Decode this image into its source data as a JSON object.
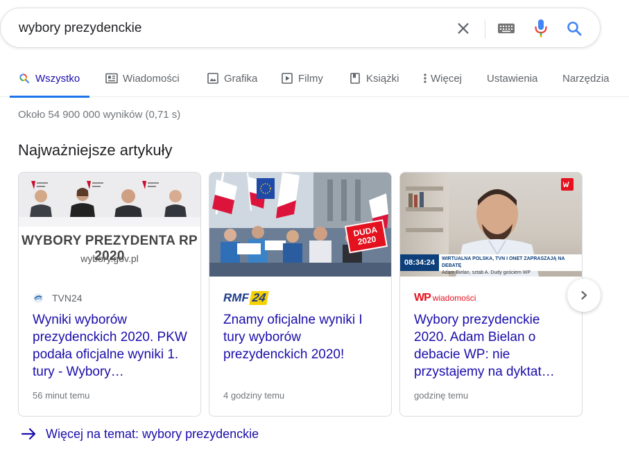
{
  "search": {
    "query": "wybory prezydenckie"
  },
  "tabs": [
    {
      "label": "Wszystko",
      "icon": "search-icon",
      "active": true
    },
    {
      "label": "Wiadomości",
      "icon": "news-icon"
    },
    {
      "label": "Grafika",
      "icon": "image-icon"
    },
    {
      "label": "Filmy",
      "icon": "video-icon"
    },
    {
      "label": "Książki",
      "icon": "book-icon"
    },
    {
      "label": "Więcej",
      "icon": "more-vert-icon"
    },
    {
      "label": "Ustawienia"
    },
    {
      "label": "Narzędzia"
    }
  ],
  "result_stats": "Około 54 900 000 wyników (0,71 s)",
  "top_stories": {
    "title": "Najważniejsze artykuły",
    "cards": [
      {
        "source": "TVN24",
        "headline": "Wyniki wyborów prezydenckich 2020. PKW podała oficjalne wyniki 1. tury - Wybory…",
        "time": "56 minut temu",
        "thumb_text": "WYBORY PREZYDENTA RP 2020",
        "thumb_subtext": "wybory.gov.pl"
      },
      {
        "source": "RMF 24",
        "source_logo_left": "RMF",
        "source_logo_right": "24",
        "headline": "Znamy oficjalne wyniki I tury wyborów prezydenckich 2020!",
        "time": "4 godziny temu",
        "thumb_sign_line1": "DUDA",
        "thumb_sign_line2": "2020"
      },
      {
        "source": "wiadomości",
        "source_logo_mark": "WP",
        "headline": "Wybory prezydenckie 2020. Adam Bielan o debacie WP: nie przystajemy na dyktat…",
        "time": "godzinę temu",
        "thumb_clock": "08:34:24",
        "thumb_ticker_line1": "WIRTUALNA POLSKA, TVN I ONET ZAPRASZAJĄ NA DEBATĘ",
        "thumb_ticker_line2": "Adam Bielan, sztab A. Dudy gościem WP"
      }
    ]
  },
  "more_link": "Więcej na temat: wybory prezydenckie",
  "colors": {
    "link": "#1a0dab",
    "accent": "#1a73e8",
    "muted": "#70757a",
    "wp_red": "#e4111e",
    "rmf_blue": "#1f3c88",
    "rmf_yellow": "#f5d200"
  }
}
